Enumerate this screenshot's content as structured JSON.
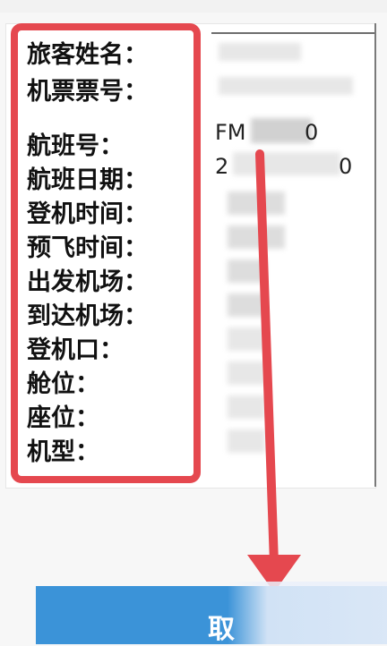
{
  "labels": [
    "旅客姓名：",
    "机票票号：",
    "航班号：",
    "航班日期：",
    "登机时间：",
    "预飞时间：",
    "出发机场：",
    "到达机场：",
    "登机口：",
    "舱位：",
    "座位：",
    "机型："
  ],
  "values": {
    "flight_number_partial": "FM",
    "flight_number_tail": "0",
    "flight_date_partial": "2",
    "flight_date_tail": "0"
  },
  "bottom_button": {
    "label": "取"
  },
  "colors": {
    "annotation_red": "#e5484f",
    "button_blue": "#3b93d8"
  }
}
